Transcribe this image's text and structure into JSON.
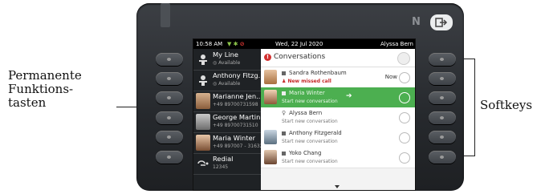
{
  "annotations": {
    "left_label": "Permanente Funktions- tasten",
    "left_lines": [
      "Permanente",
      "Funktions-",
      "tasten"
    ],
    "right_label": "Softkeys"
  },
  "status_bar": {
    "time": "10:58 AM",
    "date": "Wed, 22 Jul 2020",
    "user": "Alyssa Bern"
  },
  "left_keys": [
    {
      "name": "My Line",
      "sub": "Available",
      "icon": "line-icon"
    },
    {
      "name": "Anthony Fitzg..",
      "sub": "Available",
      "icon": "line-icon"
    },
    {
      "name": "Marianne Jen..",
      "sub": "+49 89700731598",
      "icon": "avatar"
    },
    {
      "name": "George Martin",
      "sub": "+49 89700731510",
      "icon": "avatar"
    },
    {
      "name": "Maria Winter",
      "sub": "+49 897007 - 31632",
      "icon": "avatar"
    },
    {
      "name": "Redial",
      "sub": "12345",
      "icon": "redial-icon"
    }
  ],
  "conversations": {
    "title": "Conversations",
    "items": [
      {
        "name": "Sandra Rothenbaum",
        "sub": "New missed call",
        "missed": true,
        "time": "Now",
        "selected": false
      },
      {
        "name": "Maria Winter",
        "sub": "Start new conversation",
        "missed": false,
        "time": "",
        "selected": true
      },
      {
        "name": "Alyssa Bern",
        "sub": "Start new conversation",
        "missed": false,
        "time": "",
        "selected": false
      },
      {
        "name": "Anthony Fitzgerald",
        "sub": "Start new conversation",
        "missed": false,
        "time": "",
        "selected": false
      },
      {
        "name": "Yoko Chang",
        "sub": "Start new conversation",
        "missed": false,
        "time": "",
        "selected": false
      }
    ]
  },
  "colors": {
    "selected_row": "#4caf50",
    "missed_call": "#c62828",
    "phone_body": "#2b2e32"
  }
}
